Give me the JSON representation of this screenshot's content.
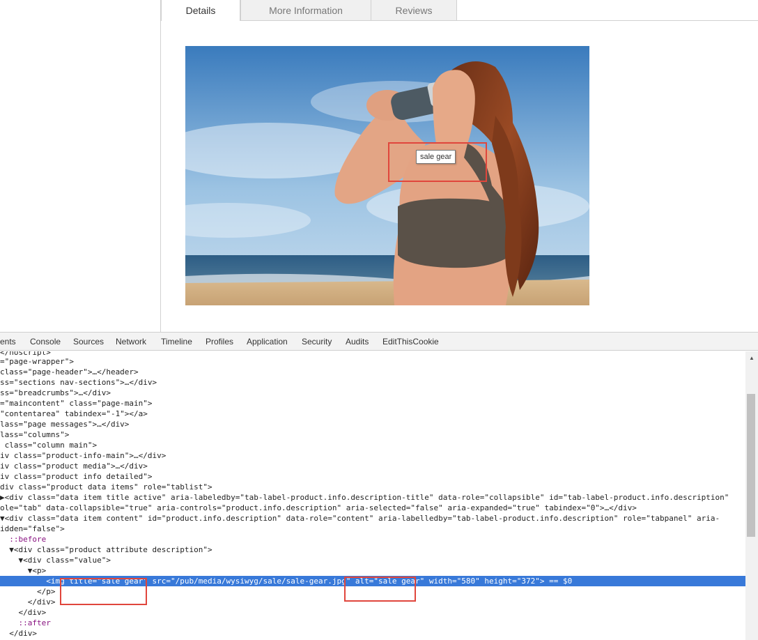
{
  "tabs": [
    {
      "label": "Details"
    },
    {
      "label": "More Information"
    },
    {
      "label": "Reviews"
    }
  ],
  "image": {
    "title": "sale gear",
    "tooltip": "sale gear"
  },
  "devtools": {
    "tabs": [
      "ents",
      "Console",
      "Sources",
      "Network",
      "Timeline",
      "Profiles",
      "Application",
      "Security",
      "Audits",
      "EditThisCookie"
    ],
    "lines": [
      "</noscript>",
      "=\"page-wrapper\">",
      "class=\"page-header\">…</header>",
      "ss=\"sections nav-sections\">…</div>",
      "ss=\"breadcrumbs\">…</div>",
      "=\"maincontent\" class=\"page-main\">",
      "\"contentarea\" tabindex=\"-1\"></a>",
      "lass=\"page messages\">…</div>",
      "lass=\"columns\">",
      " class=\"column main\">",
      "iv class=\"product-info-main\">…</div>",
      "iv class=\"product media\">…</div>",
      "iv class=\"product info detailed\">",
      "div class=\"product data items\" role=\"tablist\">",
      "▶<div class=\"data item title active\" aria-labeledby=\"tab-label-product.info.description-title\" data-role=\"collapsible\" id=\"tab-label-product.info.description\"",
      "ole=\"tab\" data-collapsible=\"true\" aria-controls=\"product.info.description\" aria-selected=\"false\" aria-expanded=\"true\" tabindex=\"0\">…</div>",
      "▼<div class=\"data item content\" id=\"product.info.description\" data-role=\"content\" aria-labelledby=\"tab-label-product.info.description\" role=\"tabpanel\" aria-",
      "idden=\"false\">",
      "  ::before",
      "  ▼<div class=\"product attribute description\">",
      "    ▼<div class=\"value\">",
      "      ▼<p>",
      "          <img title=\"sale gear\" src=\"/pub/media/wysiwyg/sale/sale-gear.jpg\" alt=\"sale gear\" width=\"580\" height=\"372\"> == $0",
      "        </p>",
      "      </div>",
      "    </div>",
      "    ::after",
      "  </div>"
    ]
  }
}
